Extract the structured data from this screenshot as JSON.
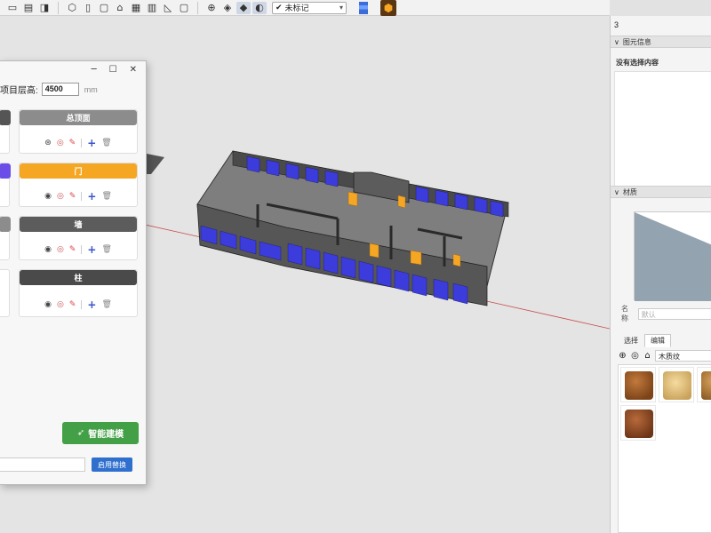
{
  "toolbar": {
    "tag_select": "未标记",
    "icons": [
      "section-icon",
      "table-icon",
      "panel-icon",
      "cube-outline-icon",
      "door-icon",
      "doc-icon",
      "building-icon",
      "grid-icon",
      "column-icon",
      "wall-icon",
      "page-icon",
      "orbit-icon",
      "iso-view-icon",
      "front-view-icon",
      "side-view-icon"
    ]
  },
  "dialog": {
    "height_label": "项目层高:",
    "height_value": "4500",
    "height_unit": "mm",
    "categories": [
      {
        "label": "总顶面",
        "color": "#8c8c8c"
      },
      {
        "label": "门",
        "color": "#f5a623"
      },
      {
        "label": "墙",
        "color": "#5c5c5c"
      },
      {
        "label": "柱",
        "color": "#4a4a4a"
      }
    ],
    "left_strip_colors": [
      "#555555",
      "#6b4de8",
      "#8c8c8c"
    ],
    "action_glyphs": {
      "target": "◉",
      "eye": "◎",
      "pen": "✎",
      "plus": "+",
      "trash": "🗑"
    },
    "smart_button": "智能建模",
    "replace_button": "启用替换"
  },
  "right_panel": {
    "top_number": "3",
    "entity_info_title": "图元信息",
    "no_selection": "没有选择内容",
    "materials_title": "材质",
    "name_label": "名称",
    "name_placeholder": "默认",
    "tabs": [
      "选择",
      "编辑"
    ],
    "library": "木质纹"
  }
}
